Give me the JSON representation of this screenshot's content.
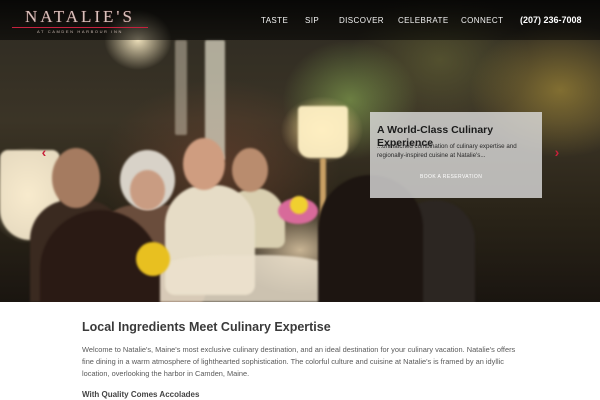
{
  "header": {
    "logo": {
      "name": "NATALIE'S",
      "tagline": "AT CAMDEN HARBOUR INN"
    },
    "nav": [
      {
        "label": "TASTE"
      },
      {
        "label": "SIP"
      },
      {
        "label": "DISCOVER"
      },
      {
        "label": "CELEBRATE"
      },
      {
        "label": "CONNECT"
      }
    ],
    "phone": "(207) 236-7008"
  },
  "hero": {
    "prev_icon": "chevron-left-icon",
    "next_icon": "chevron-right-icon",
    "promo": {
      "title": "A World-Class Culinary Experience",
      "text": "...unmatched combination of culinary expertise and regionally-inspired cuisine at Natalie's...",
      "button_label": "BOOK A RESERVATION"
    }
  },
  "main": {
    "heading": "Local Ingredients Meet Culinary Expertise",
    "intro": "Welcome to Natalie's, Maine's most exclusive culinary destination, and an ideal destination for your culinary vacation. Natalie's offers fine dining in a warm atmosphere of lighthearted sophistication. The colorful culture and cuisine at Natalie's is framed by an idyllic location, overlooking the harbor in Camden, Maine.",
    "subheading": "With Quality Comes Accolades"
  },
  "colors": {
    "accent": "#c8203a",
    "nav_text": "#f2f2f2",
    "heading": "#3a3a3a",
    "body_text": "#5a5a5a"
  }
}
